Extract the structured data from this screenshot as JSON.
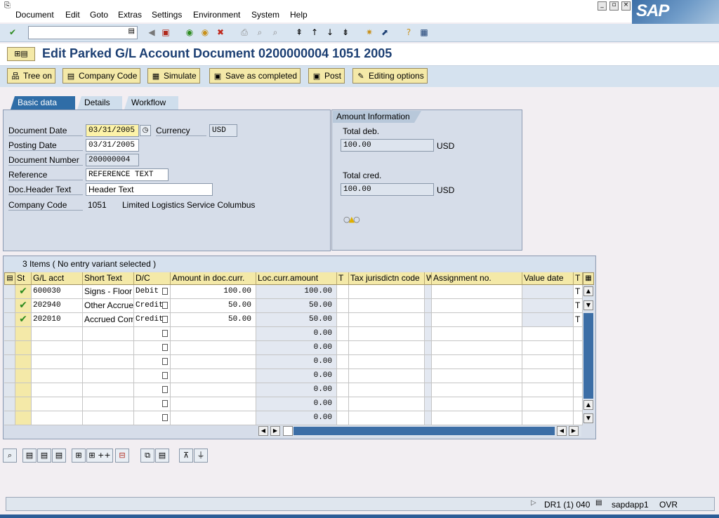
{
  "menu": [
    "Document",
    "Edit",
    "Goto",
    "Extras",
    "Settings",
    "Environment",
    "System",
    "Help"
  ],
  "window_buttons": [
    "minimize-icon",
    "restore-icon",
    "close-icon"
  ],
  "sap_logo_text": "SAP",
  "toolbar": {
    "command_value": ""
  },
  "title": "Edit Parked G/L Account Document 0200000004 1051 2005",
  "app_toolbar": {
    "tree_on": "Tree on",
    "company_code": "Company Code",
    "simulate": "Simulate",
    "save_completed": "Save as completed",
    "post": "Post",
    "editing_options": "Editing options"
  },
  "tabs": [
    "Basic data",
    "Details",
    "Workflow"
  ],
  "basic": {
    "doc_date_label": "Document Date",
    "doc_date": "03/31/2005",
    "currency_label": "Currency",
    "currency": "USD",
    "posting_date_label": "Posting Date",
    "posting_date": "03/31/2005",
    "doc_number_label": "Document Number",
    "doc_number": "200000004",
    "reference_label": "Reference",
    "reference": "REFERENCE TEXT",
    "header_text_label": "Doc.Header Text",
    "header_text": "Header Text",
    "company_code_label": "Company Code",
    "company_code": "1051",
    "company_name": "Limited Logistics Service Columbus"
  },
  "amount": {
    "header": "Amount Information",
    "total_deb_label": "Total deb.",
    "total_deb": "100.00",
    "total_deb_cur": "USD",
    "total_cred_label": "Total cred.",
    "total_cred": "100.00",
    "total_cred_cur": "USD"
  },
  "table": {
    "caption": "3 Items ( No entry variant selected )",
    "columns": [
      "St",
      "G/L acct",
      "Short Text",
      "D/C",
      "Amount in doc.curr.",
      "Loc.curr.amount",
      "T",
      "Tax jurisdictn code",
      "W",
      "Assignment no.",
      "Value date",
      "T"
    ],
    "rows": [
      {
        "status": true,
        "gl": "600030",
        "short": "Signs - Floor",
        "dc": "Debit",
        "amount": "100.00",
        "loc": "100.00",
        "tail": "T"
      },
      {
        "status": true,
        "gl": "202940",
        "short": "Other Accrued",
        "dc": "Credit",
        "amount": "50.00",
        "loc": "50.00",
        "tail": "T"
      },
      {
        "status": true,
        "gl": "202010",
        "short": "Accrued Com",
        "dc": "Credit",
        "amount": "50.00",
        "loc": "50.00",
        "tail": "T"
      },
      {
        "status": false,
        "gl": "",
        "short": "",
        "dc": "",
        "amount": "",
        "loc": "0.00",
        "tail": ""
      },
      {
        "status": false,
        "gl": "",
        "short": "",
        "dc": "",
        "amount": "",
        "loc": "0.00",
        "tail": ""
      },
      {
        "status": false,
        "gl": "",
        "short": "",
        "dc": "",
        "amount": "",
        "loc": "0.00",
        "tail": ""
      },
      {
        "status": false,
        "gl": "",
        "short": "",
        "dc": "",
        "amount": "",
        "loc": "0.00",
        "tail": ""
      },
      {
        "status": false,
        "gl": "",
        "short": "",
        "dc": "",
        "amount": "",
        "loc": "0.00",
        "tail": ""
      },
      {
        "status": false,
        "gl": "",
        "short": "",
        "dc": "",
        "amount": "",
        "loc": "0.00",
        "tail": ""
      },
      {
        "status": false,
        "gl": "",
        "short": "",
        "dc": "",
        "amount": "",
        "loc": "0.00",
        "tail": ""
      }
    ]
  },
  "status": {
    "system": "DR1 (1) 040",
    "server": "sapdapp1",
    "mode": "OVR"
  },
  "colors": {
    "title": "#1c3f73",
    "tab_active": "#2f6da7",
    "button": "#f4e9a8",
    "statusbar": "#dfe6ee"
  }
}
